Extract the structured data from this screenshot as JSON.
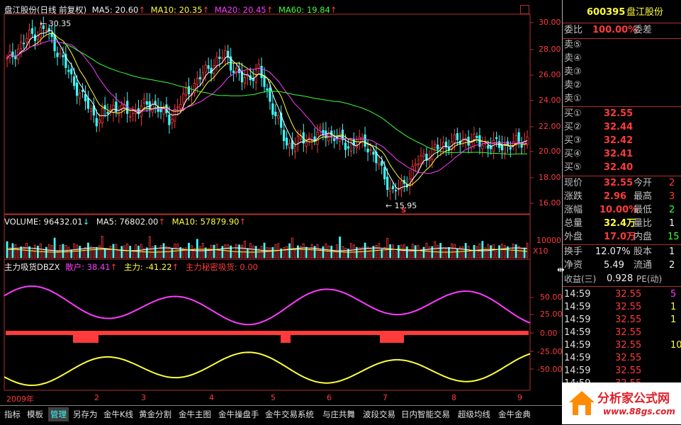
{
  "price_header": {
    "name": "盘江股份(日线 前复权)",
    "ma5": "MA5: 20.60",
    "ma10": "MA10: 20.35",
    "ma20": "MA20: 20.45",
    "ma60": "MA60: 19.84"
  },
  "volume_header": {
    "volume": "VOLUME: 96432.01",
    "ma5": "MA5: 76802.00",
    "ma10": "MA10: 57879.90"
  },
  "indicator_header": {
    "name": "主力吸货DBZX",
    "sanhu": "散户: 38.41",
    "zhuli": "主力: -41.22",
    "secret": "主力秘密吸货: 0.00"
  },
  "price_axis": [
    "30.00",
    "28.00",
    "26.00",
    "24.00",
    "22.00",
    "20.00",
    "18.00",
    "16.00"
  ],
  "volume_axis": [
    "10000",
    "X10"
  ],
  "indicator_axis": [
    "50.00",
    "25.00",
    "0.00",
    "-25.00",
    "-50.00"
  ],
  "annotations": {
    "high": "30.35",
    "low": "15.95",
    "s_marker": "S"
  },
  "time_axis": [
    "2009年",
    "2",
    "3",
    "4",
    "5",
    "6",
    "7",
    "8",
    "9"
  ],
  "tabs": [
    "指标",
    "模板",
    "管理",
    "另存为",
    "金牛K线",
    "黄金分割",
    "金牛主图",
    "金牛操盘手",
    "金牛交易系统",
    "与庄共舞",
    "波段交易",
    "日内智能交易",
    "超级均线",
    "金牛金典"
  ],
  "quote": {
    "code": "600395",
    "name": "盘江股份",
    "weibi_label": "委比",
    "weibi_value": "100.00%",
    "weicha_label": "委差",
    "sells": [
      "卖⑤",
      "卖④",
      "卖③",
      "卖②",
      "卖①"
    ],
    "buys": [
      {
        "label": "买①",
        "price": "32.55"
      },
      {
        "label": "买②",
        "price": "32.44"
      },
      {
        "label": "买③",
        "price": "32.42"
      },
      {
        "label": "买④",
        "price": "32.41"
      },
      {
        "label": "买⑤",
        "price": "32.40"
      }
    ],
    "stats": [
      {
        "l1": "现价",
        "v1": "32.55",
        "l2": "今开",
        "v2": "2"
      },
      {
        "l1": "涨跌",
        "v1": "2.96",
        "l2": "最高",
        "v2": "3"
      },
      {
        "l1": "涨幅",
        "v1": "10.00%",
        "l2": "最低",
        "v2": "2"
      },
      {
        "l1": "总量",
        "v1": "32.4万",
        "l2": "量比",
        "v2": "1"
      },
      {
        "l1": "外盘",
        "v1": "17.0万",
        "l2": "内盘",
        "v2": "15"
      }
    ],
    "stats2": [
      {
        "l1": "换手",
        "v1": "12.07%",
        "l2": "股本",
        "v2": "1"
      },
      {
        "l1": "净资",
        "v1": "5.49",
        "l2": "流通",
        "v2": "2"
      },
      {
        "l1": "收益(三)",
        "v1": "0.928",
        "l2": "PE(动)",
        "v2": ""
      }
    ],
    "ticks": [
      {
        "t": "14:59",
        "p": "32.55",
        "v": "5"
      },
      {
        "t": "14:59",
        "p": "32.55",
        "v": "1"
      },
      {
        "t": "14:59",
        "p": "32.55",
        "v": "1"
      },
      {
        "t": "14:59",
        "p": "32.55",
        "v": ""
      },
      {
        "t": "14:59",
        "p": "32.55",
        "v": "10"
      },
      {
        "t": "14:59",
        "p": "32.55",
        "v": ""
      },
      {
        "t": "14:59",
        "p": "32.55",
        "v": ""
      },
      {
        "t": "14:59",
        "p": "32.55",
        "v": ""
      }
    ]
  },
  "watermark": {
    "title": "分析家公式网",
    "url": "www.88gs.com"
  },
  "colors": {
    "up": "#ff3b3b",
    "down": "#3bffff",
    "ma5": "#ffffff",
    "ma10": "#ffff3b",
    "ma20": "#ff3bff",
    "ma60": "#3bff3b"
  }
}
